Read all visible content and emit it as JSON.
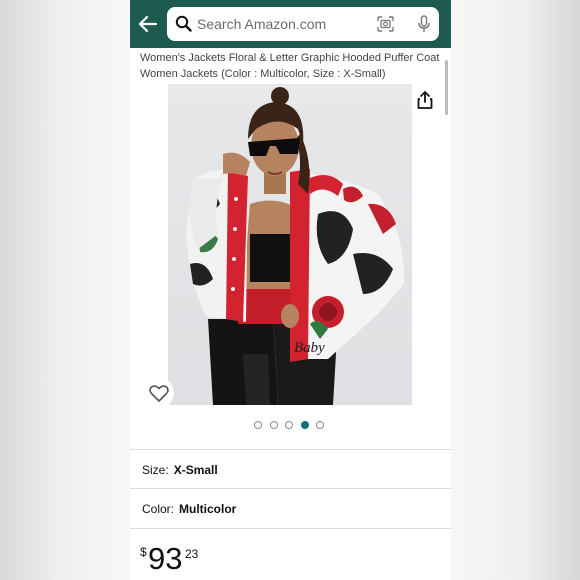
{
  "search": {
    "placeholder": "Search Amazon.com"
  },
  "product": {
    "title": "Women's Jackets Floral & Letter Graphic Hooded Puffer Coat Women Jackets (Color : Multicolor, Size : X-Small)",
    "image_text": "Baby"
  },
  "carousel": {
    "count": 5,
    "active_index": 4
  },
  "size": {
    "label": "Size:",
    "value": "X-Small"
  },
  "color": {
    "label": "Color:",
    "value": "Multicolor"
  },
  "price": {
    "currency": "$",
    "whole": "93",
    "fraction": "23"
  },
  "colors": {
    "header": "#1f5a50",
    "active_dot": "#11707a"
  }
}
